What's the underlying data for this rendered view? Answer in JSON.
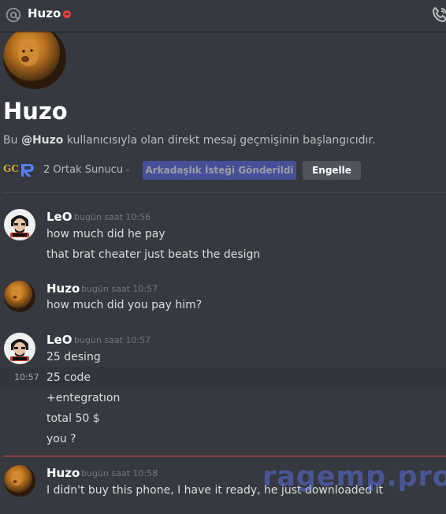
{
  "header": {
    "recipient": "Huzo",
    "at_icon": "at-icon",
    "status_icon": "do-not-disturb-icon",
    "call_icon": "phone-call-icon"
  },
  "profile": {
    "name": "Huzo",
    "intro_prefix": "Bu ",
    "intro_handle": "@Huzo",
    "intro_suffix": " kullanıcısıyla olan direkt mesaj geçmişinin başlangıcıdır.",
    "mutual_server_1_text": "GC",
    "mutual_servers": "2 Ortak Sunucu",
    "friend_request_label": "Arkadaşlık İsteği Gönderildi",
    "block_label": "Engelle"
  },
  "messages": [
    {
      "author": "LeO",
      "time": "bugün saat 10:56",
      "lines": [
        "how much did he pay",
        "that brat cheater just beats the design"
      ]
    },
    {
      "author": "Huzo",
      "time": "bugün saat 10:57",
      "lines": [
        "how much did you pay him?"
      ]
    },
    {
      "author": "LeO",
      "time": "bugün saat 10:57",
      "lines": [
        "25 desing",
        "25 code",
        "+entegratıon",
        "total 50 $",
        "you ?"
      ],
      "hover_time": "10:57"
    },
    {
      "author": "Huzo",
      "time": "bugün saat 10:58",
      "lines": [
        "I didn't buy this phone, I have it ready, he just downloaded it"
      ]
    }
  ],
  "watermark": "ragemp.pro",
  "colors": {
    "background": "#36393f",
    "accent": "#5865f2",
    "danger": "#ed4245",
    "text": "#dcddde",
    "muted": "#72767d"
  }
}
